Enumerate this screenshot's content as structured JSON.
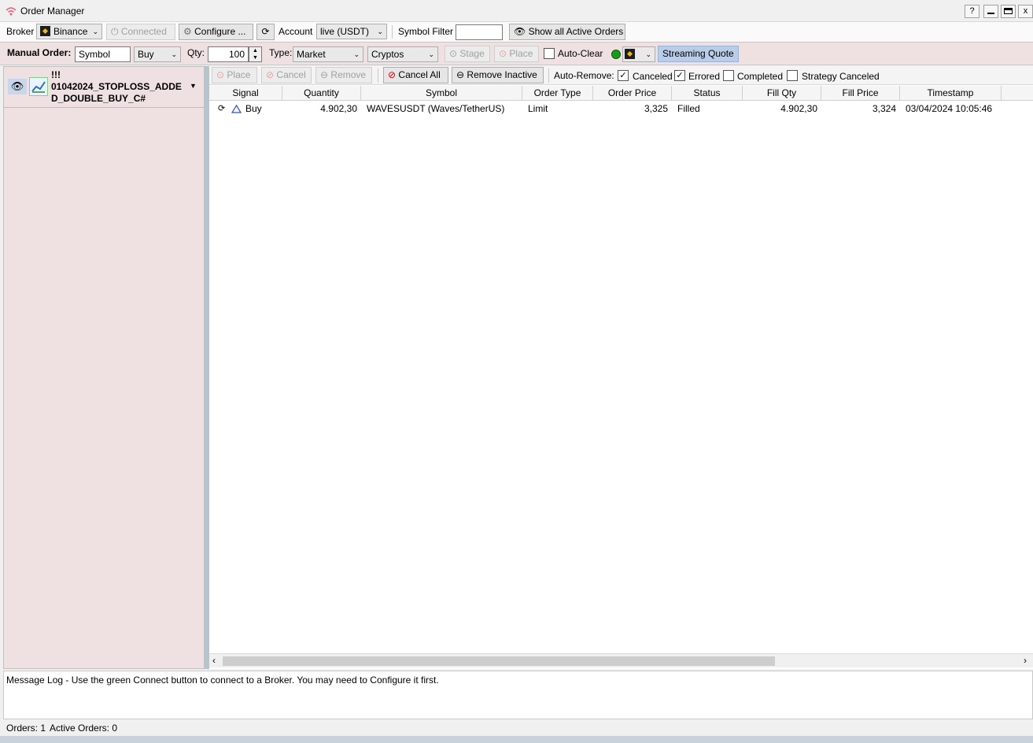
{
  "window": {
    "title": "Order Manager",
    "help_label": "?",
    "close_label": "x"
  },
  "toolbar1": {
    "broker_label": "Broker",
    "broker_value": "Binance",
    "connected_label": "Connected",
    "configure_label": "Configure ...",
    "account_label": "Account",
    "account_value": "live (USDT)",
    "symbol_filter_label": "Symbol Filter",
    "symbol_filter_value": "",
    "show_active_label": "Show all Active Orders"
  },
  "manual_order": {
    "label": "Manual Order:",
    "symbol_value": "Symbol",
    "side_value": "Buy",
    "qty_label": "Qty:",
    "qty_value": "100",
    "type_label": "Type:",
    "type_value": "Market",
    "asset_value": "Cryptos",
    "stage_label": "Stage",
    "place_label": "Place",
    "auto_clear_label": "Auto-Clear",
    "streaming_label": "Streaming Quote"
  },
  "strategy": {
    "name_line1": "!!!",
    "name_line2": "01042024_STOPLOSS_ADDE",
    "name_line3": "D_DOUBLE_BUY_C#"
  },
  "order_toolbar": {
    "place_label": "Place",
    "cancel_label": "Cancel",
    "remove_label": "Remove",
    "cancel_all_label": "Cancel All",
    "remove_inactive_label": "Remove Inactive",
    "auto_remove_label": "Auto-Remove:",
    "canceled_label": "Canceled",
    "errored_label": "Errored",
    "completed_label": "Completed",
    "strategy_canceled_label": "Strategy Canceled"
  },
  "table": {
    "headers": [
      "Signal",
      "Quantity",
      "Symbol",
      "Order Type",
      "Order Price",
      "Status",
      "Fill Qty",
      "Fill Price",
      "Timestamp"
    ],
    "rows": [
      {
        "signal": "Buy",
        "quantity": "4.902,30",
        "symbol": "WAVESUSDT (Waves/TetherUS)",
        "order_type": "Limit",
        "order_price": "3,325",
        "status": "Filled",
        "fill_qty": "4.902,30",
        "fill_price": "3,324",
        "timestamp": "03/04/2024 10:05:46"
      }
    ]
  },
  "message_log": "Message Log - Use the green Connect button to connect to a Broker. You may need to Configure it first.",
  "status": {
    "orders": "Orders: 1",
    "active_orders": "Active Orders: 0"
  },
  "colors": {
    "accent_yellow": "#f0b90b",
    "connected_green": "#1a9b1a",
    "streaming_bg": "#b9cde8",
    "panel_pink": "#efe1e1"
  }
}
